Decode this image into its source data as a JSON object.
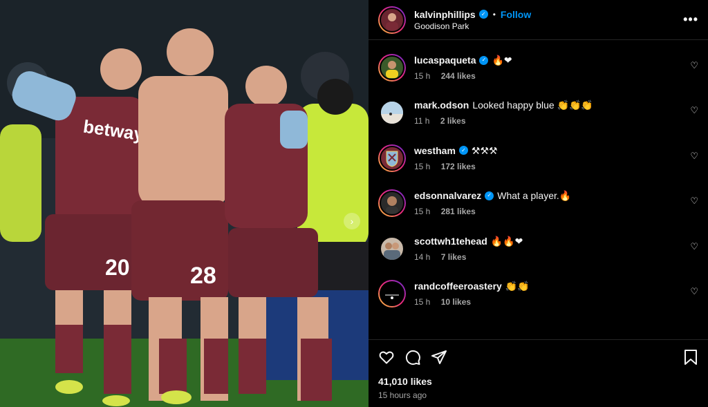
{
  "post": {
    "username": "kalvinphillips",
    "follow_label": "Follow",
    "location": "Goodison Park",
    "more_label": "•••"
  },
  "comments": [
    {
      "user": "lucaspaqueta",
      "verified": true,
      "text": "🔥❤",
      "time": "15 h",
      "likes": "244 likes"
    },
    {
      "user": "mark.odson",
      "verified": false,
      "text": "Looked happy blue 👏👏👏",
      "time": "11 h",
      "likes": "2 likes"
    },
    {
      "user": "westham",
      "verified": true,
      "text": "⚒⚒⚒",
      "time": "15 h",
      "likes": "172 likes"
    },
    {
      "user": "edsonnalvarez",
      "verified": true,
      "text": "What a player.🔥",
      "time": "15 h",
      "likes": "281 likes"
    },
    {
      "user": "scottwh1tehead",
      "verified": false,
      "text": "🔥🔥❤",
      "time": "14 h",
      "likes": "7 likes"
    },
    {
      "user": "randcoffeeroastery",
      "verified": false,
      "text": "👏👏",
      "time": "15 h",
      "likes": "10 likes"
    }
  ],
  "footer": {
    "like_count": "41,010 likes",
    "posted": "15 hours ago"
  },
  "photo": {
    "shirt_sponsor": "betway",
    "numbers": [
      "20",
      "28"
    ]
  },
  "colors": {
    "accent": "#0095f6",
    "claret": "#7a2a36",
    "sky_blue": "#8fb8d8",
    "hi_vis": "#c7e83a"
  }
}
